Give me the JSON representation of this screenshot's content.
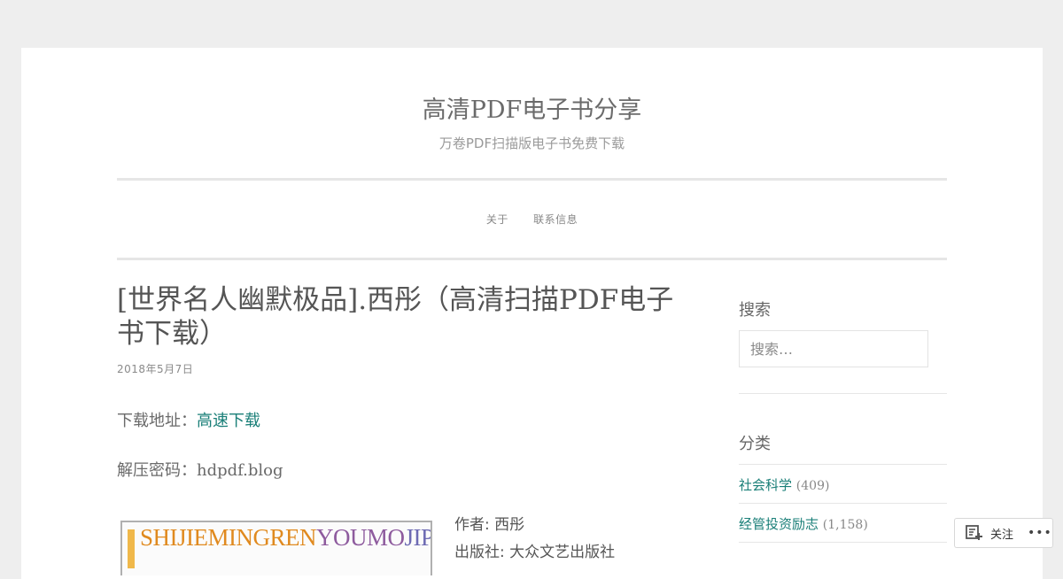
{
  "site": {
    "title": "高清PDF电子书分享",
    "description": "万卷PDF扫描版电子书免费下载"
  },
  "nav": {
    "items": [
      {
        "label": "关于"
      },
      {
        "label": "联系信息"
      }
    ]
  },
  "post": {
    "title": "[世界名人幽默极品].西彤（高清扫描PDF电子书下载）",
    "date": "2018年5月7日",
    "download_label": "下载地址：",
    "download_link": "高速下载",
    "password_label": "解压密码：",
    "password_value": "hdpdf.blog",
    "cover": {
      "part1": "SHIJIEMINGREN",
      "part2": "YOUMO",
      "part3": "JIPIN"
    },
    "meta": {
      "author": "作者: 西彤",
      "publisher": "出版社: 大众文艺出版社"
    }
  },
  "sidebar": {
    "search_title": "搜索",
    "search_placeholder": "搜索…",
    "categories_title": "分类",
    "categories": [
      {
        "name": "社会科学",
        "count": "(409)"
      },
      {
        "name": "经管投资励志",
        "count": "(1,158)"
      }
    ]
  },
  "follow": {
    "label": "关注",
    "more": "•••"
  }
}
